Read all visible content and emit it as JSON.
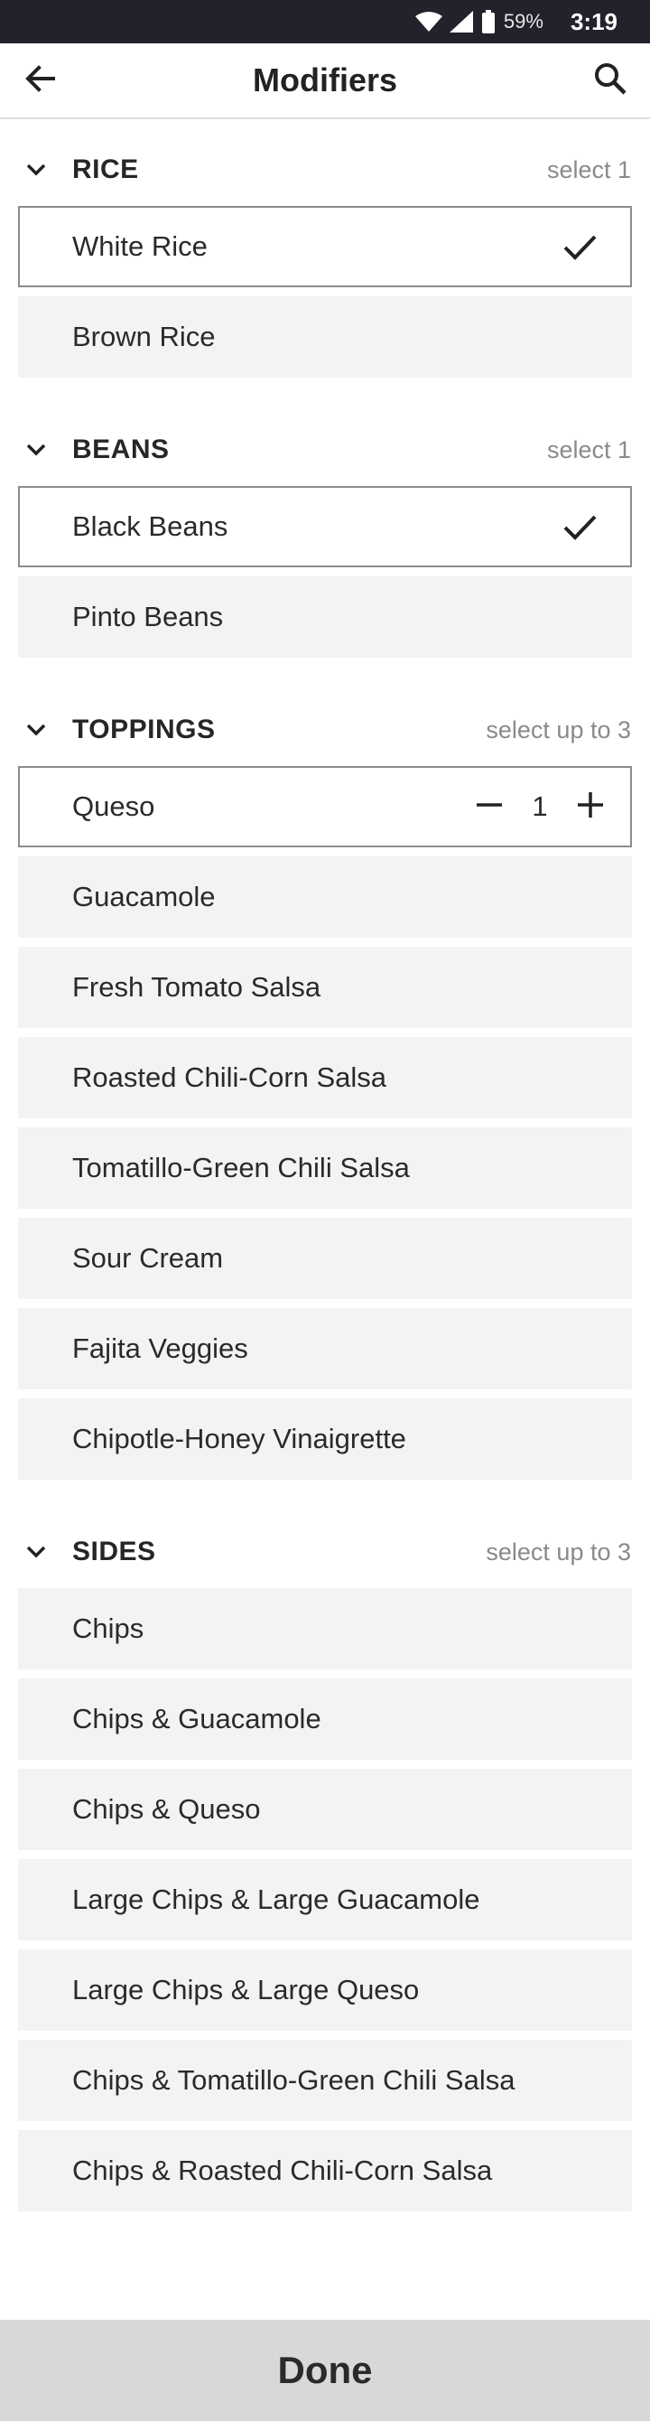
{
  "status_bar": {
    "battery": "59%",
    "time": "3:19",
    "icons": [
      "wifi-icon",
      "signal-icon",
      "battery-icon"
    ]
  },
  "header": {
    "title": "Modifiers",
    "back_icon": "arrow-back-icon",
    "search_icon": "search-icon"
  },
  "sections": [
    {
      "title": "RICE",
      "hint": "select 1",
      "options": [
        {
          "label": "White Rice",
          "selected": true
        },
        {
          "label": "Brown Rice",
          "selected": false
        }
      ]
    },
    {
      "title": "BEANS",
      "hint": "select 1",
      "options": [
        {
          "label": "Black Beans",
          "selected": true
        },
        {
          "label": "Pinto Beans",
          "selected": false
        }
      ]
    },
    {
      "title": "TOPPINGS",
      "hint": "select up to 3",
      "options": [
        {
          "label": "Queso",
          "selected": true,
          "quantity": "1"
        },
        {
          "label": "Guacamole"
        },
        {
          "label": "Fresh Tomato Salsa"
        },
        {
          "label": "Roasted Chili-Corn Salsa"
        },
        {
          "label": "Tomatillo-Green Chili Salsa"
        },
        {
          "label": "Sour Cream"
        },
        {
          "label": "Fajita Veggies"
        },
        {
          "label": "Chipotle-Honey Vinaigrette"
        }
      ]
    },
    {
      "title": "SIDES",
      "hint": "select up to 3",
      "options": [
        {
          "label": "Chips"
        },
        {
          "label": "Chips & Guacamole"
        },
        {
          "label": "Chips & Queso"
        },
        {
          "label": "Large Chips & Large Guacamole"
        },
        {
          "label": "Large Chips & Large Queso"
        },
        {
          "label": "Chips & Tomatillo-Green Chili Salsa"
        },
        {
          "label": "Chips & Roasted Chili-Corn Salsa"
        }
      ]
    }
  ],
  "footer": {
    "done_label": "Done"
  },
  "colors": {
    "status_bar": "#22222c",
    "option_bg": "#f3f3f3",
    "selected_border": "#8c8c8c",
    "footer_bg": "#d8d8d8",
    "hint": "#8a8a8a"
  }
}
